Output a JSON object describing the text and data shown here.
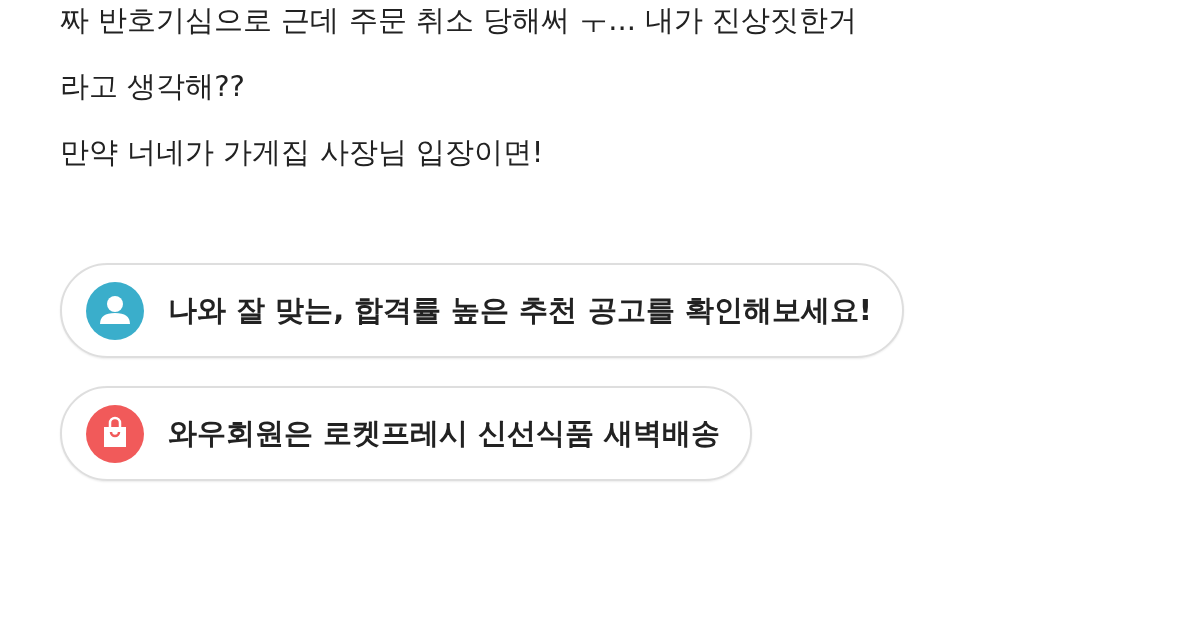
{
  "post_lines": [
    "짜 반호기심으로 근데 주문 취소 당해써 ㅜ... 내가 진상짓한거",
    "라고 생각해??",
    "만약 너네가 가게집 사장님 입장이면!"
  ],
  "banners": [
    {
      "kind": "person",
      "color": "#3aaecb",
      "text": "나와 잘 맞는, 합격률 높은 추천 공고를 확인해보세요!"
    },
    {
      "kind": "bag",
      "color": "#f15a5a",
      "text": "와우회원은 로켓프레시 신선식품 새벽배송"
    }
  ]
}
